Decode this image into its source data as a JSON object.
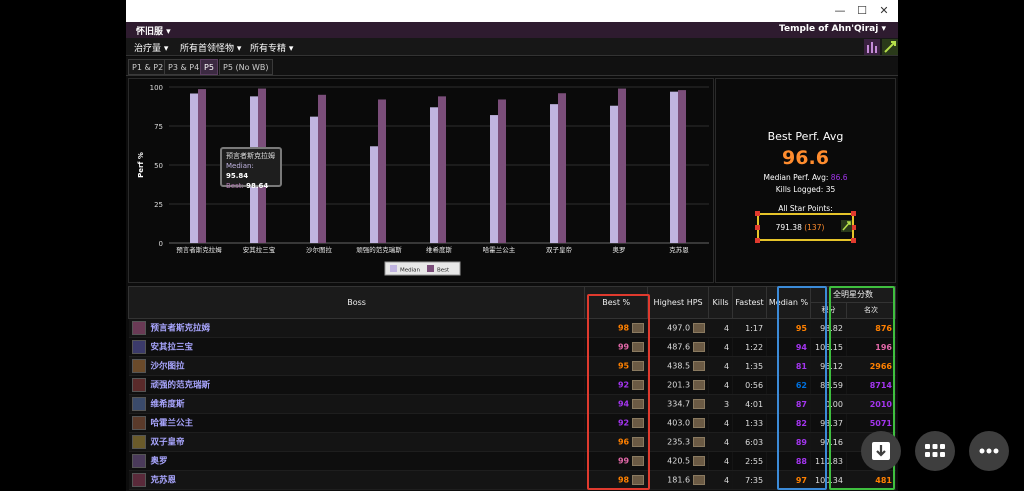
{
  "header": {
    "server": "怀旧服",
    "zone": "Temple of Ahn'Qiraj"
  },
  "filters": [
    "治疗量",
    "所有首领怪物",
    "所有专精"
  ],
  "tabs": [
    {
      "label": "P1 & P2",
      "active": false
    },
    {
      "label": "P3 & P4",
      "active": false
    },
    {
      "label": "P5",
      "active": true
    },
    {
      "label": "P5 (No WB)",
      "active": false
    }
  ],
  "chart_data": {
    "type": "bar",
    "categories": [
      "预言者斯克拉姆",
      "安其拉三宝",
      "沙尔图拉",
      "顽强的范克瑞斯",
      "维希度斯",
      "哈霍兰公主",
      "双子皇帝",
      "奥罗",
      "克苏恩"
    ],
    "series": [
      {
        "name": "Median",
        "values": [
          95.84,
          94,
          81,
          62,
          87,
          82,
          89,
          88,
          97
        ],
        "color": "#c0b4e0"
      },
      {
        "name": "Best",
        "values": [
          98.64,
          99,
          95,
          92,
          94,
          92,
          96,
          99,
          98
        ],
        "color": "#7b4e7a"
      }
    ],
    "ylabel": "Perf %",
    "ylim": [
      0,
      100
    ],
    "yticks": [
      0,
      25,
      50,
      75,
      100
    ],
    "grid": true,
    "legend": "bottom-center",
    "tooltip": {
      "title": "预言者斯克拉姆",
      "median_label": "Median:",
      "median": "95.84",
      "best_label": "Best:",
      "best": "98.64"
    }
  },
  "stats": {
    "title": "Best Perf. Avg",
    "value": "96.6",
    "median_label": "Median Perf. Avg:",
    "median_value": "86.6",
    "kills_label": "Kills Logged:",
    "kills_value": "35",
    "asp_label": "All Star Points:",
    "asp_value": "791.38",
    "asp_rank": "(137)"
  },
  "table": {
    "headers": {
      "boss": "Boss",
      "best": "Best %",
      "hps": "Highest HPS",
      "kills": "Kills",
      "fastest": "Fastest",
      "median": "Median %",
      "allstar": "全明星分数",
      "points": "积分",
      "rank": "名次"
    },
    "rows": [
      {
        "boss": "预言者斯克拉姆",
        "best": "98",
        "best_color": "#ff8000",
        "hps": "497.0",
        "kills": "4",
        "fastest": "1:17",
        "median": "95",
        "median_color": "#ff8000",
        "points": "98.82",
        "rank": "876",
        "rank_color": "#ff8000"
      },
      {
        "boss": "安其拉三宝",
        "best": "99",
        "best_color": "#e268a8",
        "hps": "487.6",
        "kills": "4",
        "fastest": "1:22",
        "median": "94",
        "median_color": "#a335ee",
        "points": "106.15",
        "rank": "196",
        "rank_color": "#e268a8"
      },
      {
        "boss": "沙尔图拉",
        "best": "95",
        "best_color": "#ff8000",
        "hps": "438.5",
        "kills": "4",
        "fastest": "1:35",
        "median": "81",
        "median_color": "#a335ee",
        "points": "96.12",
        "rank": "2966",
        "rank_color": "#ff8000"
      },
      {
        "boss": "顽强的范克瑞斯",
        "best": "92",
        "best_color": "#a335ee",
        "hps": "201.3",
        "kills": "4",
        "fastest": "0:56",
        "median": "62",
        "median_color": "#0070dd",
        "points": "88.59",
        "rank": "8714",
        "rank_color": "#a335ee"
      },
      {
        "boss": "维希度斯",
        "best": "94",
        "best_color": "#a335ee",
        "hps": "334.7",
        "kills": "3",
        "fastest": "4:01",
        "median": "87",
        "median_color": "#a335ee",
        "points": "0.00",
        "rank": "2010",
        "rank_color": "#a335ee"
      },
      {
        "boss": "哈霍兰公主",
        "best": "92",
        "best_color": "#a335ee",
        "hps": "403.0",
        "kills": "4",
        "fastest": "1:33",
        "median": "82",
        "median_color": "#a335ee",
        "points": "93.37",
        "rank": "5071",
        "rank_color": "#a335ee"
      },
      {
        "boss": "双子皇帝",
        "best": "96",
        "best_color": "#ff8000",
        "hps": "235.3",
        "kills": "4",
        "fastest": "6:03",
        "median": "89",
        "median_color": "#a335ee",
        "points": "97.16",
        "rank": "",
        "rank_color": "#ff8000"
      },
      {
        "boss": "奥罗",
        "best": "99",
        "best_color": "#e268a8",
        "hps": "420.5",
        "kills": "4",
        "fastest": "2:55",
        "median": "88",
        "median_color": "#a335ee",
        "points": "110.83",
        "rank": "",
        "rank_color": "#e268a8"
      },
      {
        "boss": "克苏恩",
        "best": "98",
        "best_color": "#ff8000",
        "hps": "181.6",
        "kills": "4",
        "fastest": "7:35",
        "median": "97",
        "median_color": "#ff8000",
        "points": "100.34",
        "rank": "481",
        "rank_color": "#ff8000"
      }
    ]
  },
  "colors": {
    "accent": "#ff8c2e",
    "highlight_red": "#e03a2e",
    "highlight_blue": "#3c8bd8",
    "highlight_green": "#3fbf3f",
    "highlight_yellow": "#e6c42a"
  },
  "fab_icons": [
    "download-icon",
    "grid-icon",
    "more-icon"
  ]
}
